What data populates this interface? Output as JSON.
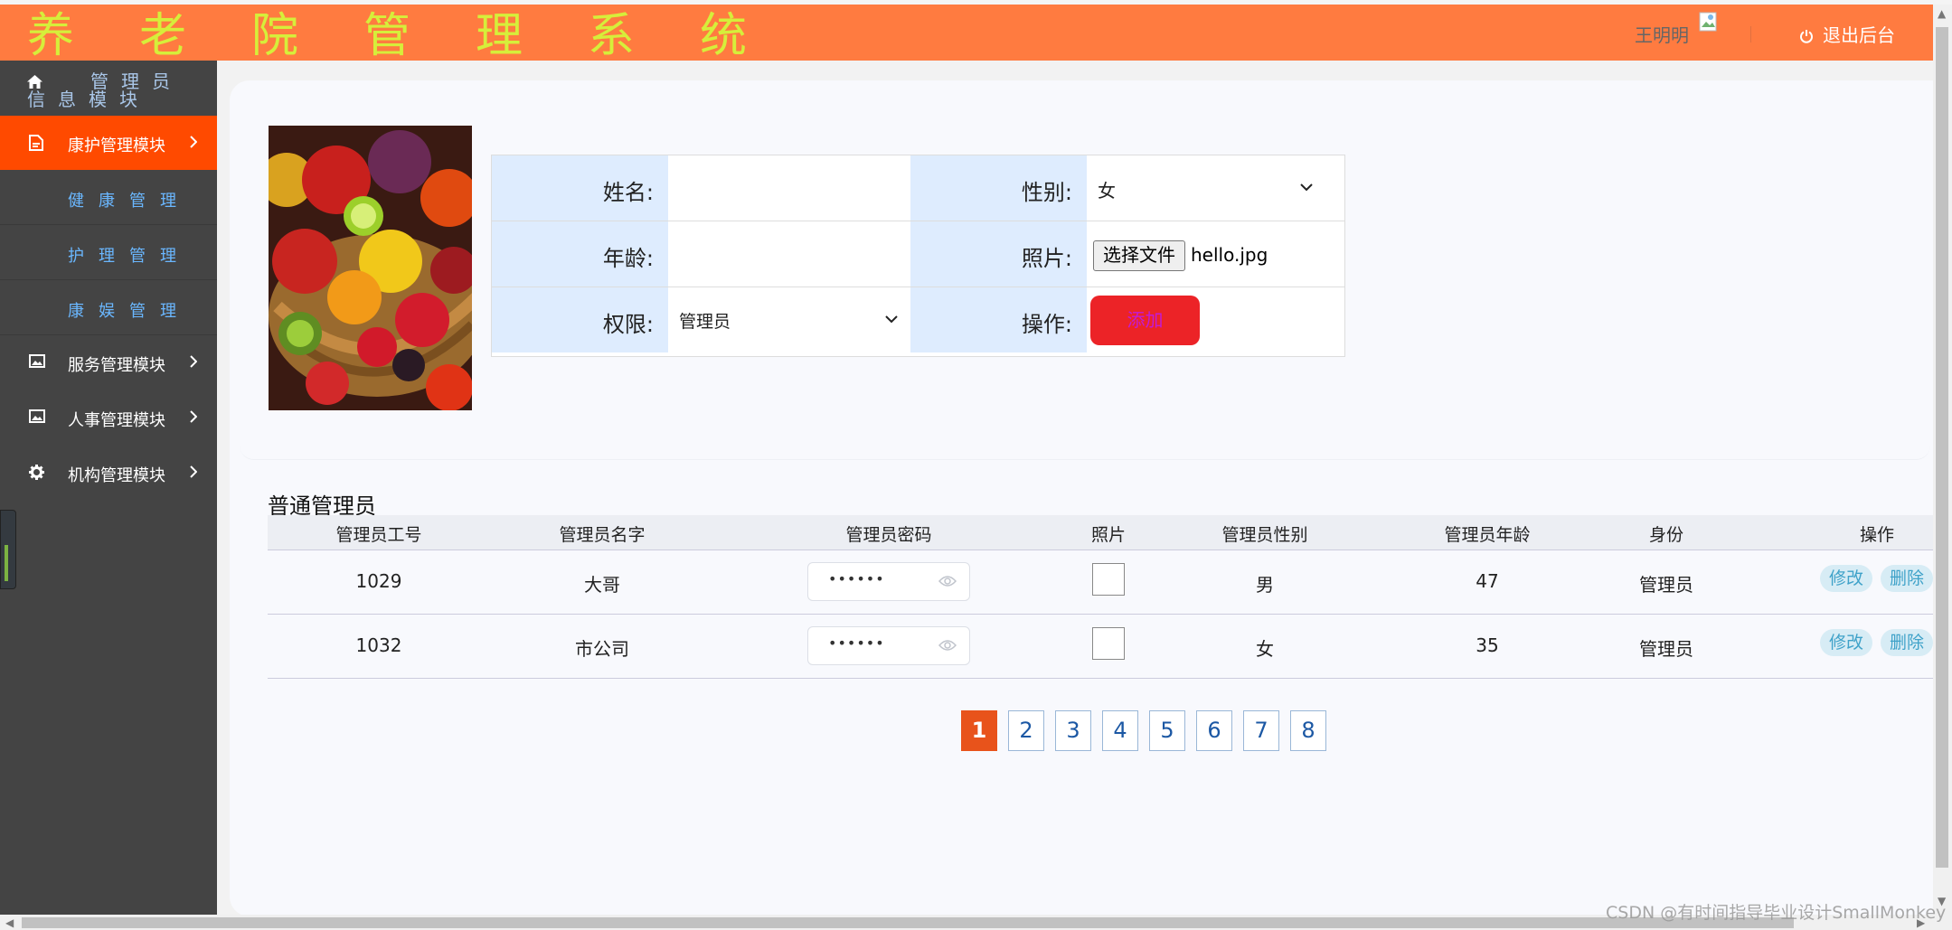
{
  "header": {
    "title": "养老院管理系统",
    "user_name": "王明明",
    "logout_label": "退出后台"
  },
  "sidebar": {
    "head_line1": "管理员",
    "head_line2": "信息模块",
    "items": [
      {
        "label": "康护管理模块",
        "icon": "file-icon",
        "active": true
      },
      {
        "label": "健康管理",
        "sub": true
      },
      {
        "label": "护理管理",
        "sub": true
      },
      {
        "label": "康娱管理",
        "sub": true
      },
      {
        "label": "服务管理模块",
        "icon": "image-icon"
      },
      {
        "label": "人事管理模块",
        "icon": "image-icon"
      },
      {
        "label": "机构管理模块",
        "icon": "gear-icon"
      }
    ]
  },
  "form": {
    "name_label": "姓名:",
    "name_value": "",
    "gender_label": "性别:",
    "gender_value": "女",
    "age_label": "年龄:",
    "age_value": "",
    "photo_label": "照片:",
    "file_button": "选择文件",
    "file_name": "hello.jpg",
    "role_label": "权限:",
    "role_value": "管理员",
    "action_label": "操作:",
    "add_button": "添加"
  },
  "table": {
    "title": "普通管理员",
    "columns": [
      "管理员工号",
      "管理员名字",
      "管理员密码",
      "照片",
      "管理员性别",
      "管理员年龄",
      "身份",
      "操作"
    ],
    "rows": [
      {
        "id": "1029",
        "name": "大哥",
        "password": "••••••",
        "gender": "男",
        "age": "47",
        "role": "管理员",
        "edit": "修改",
        "delete": "删除"
      },
      {
        "id": "1032",
        "name": "市公司",
        "password": "••••••",
        "gender": "女",
        "age": "35",
        "role": "管理员",
        "edit": "修改",
        "delete": "删除"
      }
    ]
  },
  "pagination": {
    "pages": [
      "1",
      "2",
      "3",
      "4",
      "5",
      "6",
      "7",
      "8"
    ],
    "current": "1"
  },
  "watermark": "CSDN @有时间指导毕业设计SmallMonkey",
  "colors": {
    "header": "#ff7b40",
    "title": "#d6ee3a",
    "sidebar": "#444444",
    "active_item": "#ff4a00",
    "add_button": "#ec2327",
    "page_active": "#e8531b"
  }
}
